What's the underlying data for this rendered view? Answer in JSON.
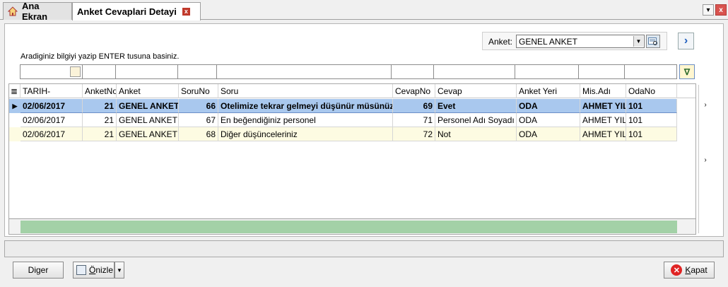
{
  "tabs": [
    {
      "label": "Ana Ekran"
    },
    {
      "label": "Anket Cevaplari Detayi"
    }
  ],
  "anket": {
    "label": "Anket:",
    "selected": "GENEL ANKET"
  },
  "search_hint": "Aradiginiz bilgiyi yazip ENTER tusuna basiniz.",
  "columns": [
    "TARIH-",
    "AnketNo",
    "Anket",
    "SoruNo",
    "Soru",
    "CevapNo",
    "Cevap",
    "Anket Yeri",
    "Mis.Adı",
    "OdaNo"
  ],
  "rows": [
    [
      "02/06/2017",
      "21",
      "GENEL ANKET",
      "66",
      "Otelimize tekrar gelmeyi düşünür müsünüz",
      "69",
      "Evet",
      "ODA",
      "AHMET YILDIZ",
      "101"
    ],
    [
      "02/06/2017",
      "21",
      "GENEL ANKET",
      "67",
      "En beğendiğiniz personel",
      "71",
      "Personel Adı Soyadı",
      "ODA",
      "AHMET YILDIZ",
      "101"
    ],
    [
      "02/06/2017",
      "21",
      "GENEL ANKET",
      "68",
      "Diğer düşünceleriniz",
      "72",
      "Not",
      "ODA",
      "AHMET YILDIZ",
      "101"
    ]
  ],
  "buttons": {
    "diger": "Diger",
    "onizle_first": "Ö",
    "onizle_rest": "nizle",
    "kapat_first": "K",
    "kapat_rest": "apat"
  },
  "colors": {
    "selected_row": "#a9c8ee",
    "alt_row": "#fdfbe2",
    "footer_green": "#a3d1a7"
  }
}
